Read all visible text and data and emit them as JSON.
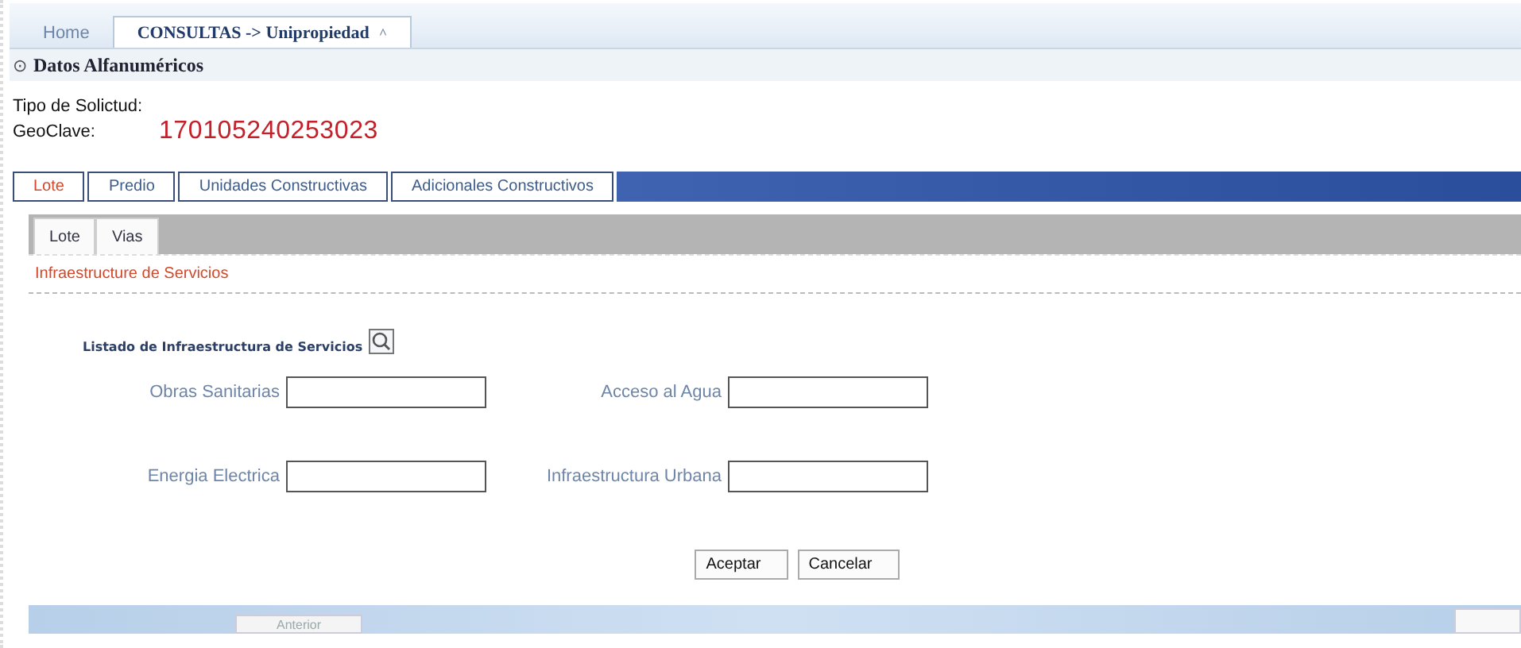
{
  "header_tabs": [
    {
      "label": "Home",
      "selected": false
    },
    {
      "label": "CONSULTAS -> Unipropiedad",
      "selected": true
    }
  ],
  "close_glyph": "^",
  "section": {
    "toggle": "⊙",
    "title": "Datos Alfanuméricos"
  },
  "request_type": {
    "label": "Tipo de Solictud:"
  },
  "geoclave": {
    "label": "GeoClave:",
    "value": "170105240253023"
  },
  "tabs": [
    {
      "label": "Lote",
      "selected": true
    },
    {
      "label": "Predio",
      "selected": false
    },
    {
      "label": "Unidades Constructivas",
      "selected": false
    },
    {
      "label": "Adicionales Constructivos",
      "selected": false
    }
  ],
  "subtabs": [
    {
      "label": "Lote"
    },
    {
      "label": "Vias"
    }
  ],
  "panel_title": "Infraestructure de Servicios",
  "list_heading": "Listado de Infraestructura de Servicios",
  "fields": [
    {
      "label": "Obras Sanitarias"
    },
    {
      "label": "Acceso al Agua"
    },
    {
      "label": "Energia Electrica"
    },
    {
      "label": "Infraestructura Urbana"
    }
  ],
  "buttons": [
    "Aceptar",
    "Cancelar"
  ],
  "footer": {
    "previous": "Anterior"
  }
}
